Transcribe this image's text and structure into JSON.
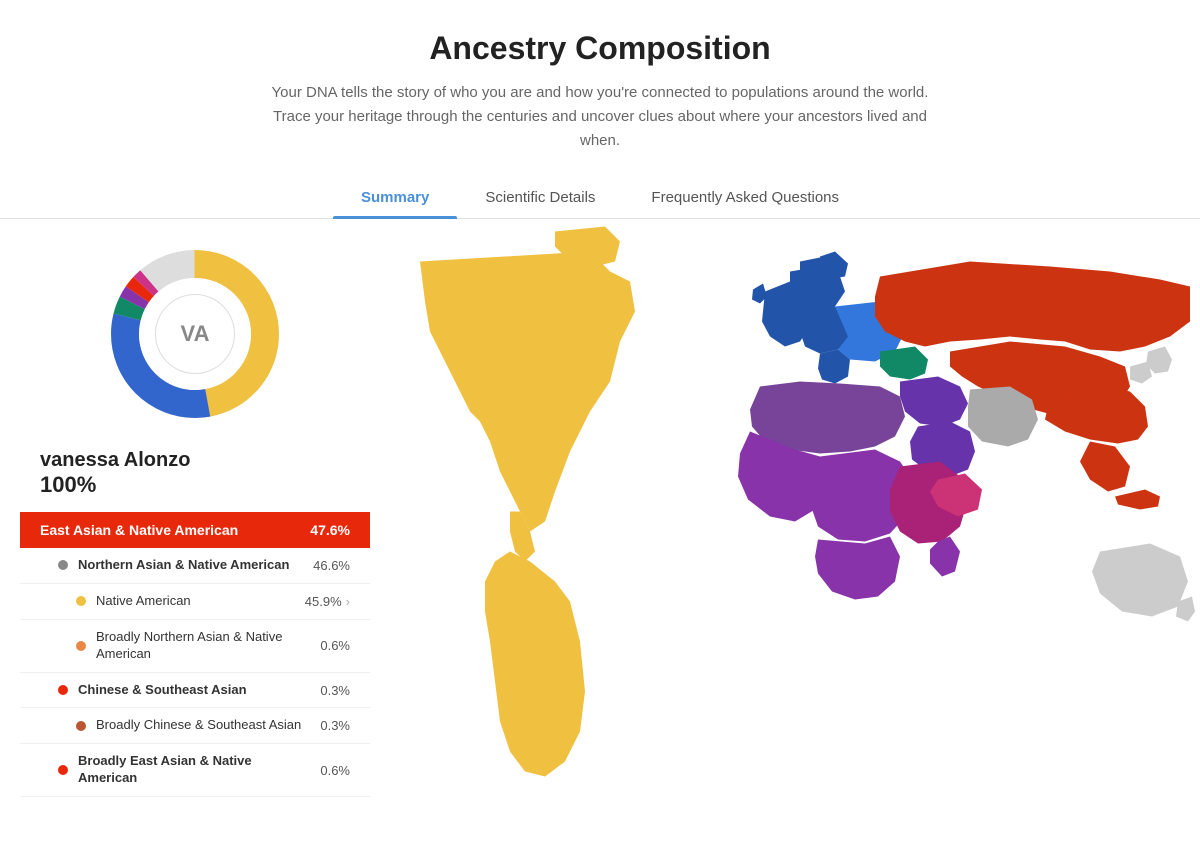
{
  "header": {
    "title": "Ancestry Composition",
    "subtitle": "Your DNA tells the story of who you are and how you're connected to populations around the world. Trace your heritage through the centuries and uncover clues about where your ancestors lived and when."
  },
  "tabs": [
    {
      "id": "summary",
      "label": "Summary",
      "active": true
    },
    {
      "id": "scientific",
      "label": "Scientific Details",
      "active": false
    },
    {
      "id": "faq",
      "label": "Frequently Asked Questions",
      "active": false
    }
  ],
  "user": {
    "initials": "VA",
    "name": "vanessa Alonzo",
    "percent": "100%"
  },
  "top_category": {
    "label": "East Asian & Native American",
    "pct": "47.6%"
  },
  "ancestry_items": [
    {
      "level": 1,
      "dot_color": "#555555",
      "name": "Northern Asian & Native American",
      "pct": "46.6%",
      "bold": true,
      "arrow": false
    },
    {
      "level": 2,
      "dot_color": "#f0c040",
      "name": "Native American",
      "pct": "45.9%",
      "bold": false,
      "arrow": true
    },
    {
      "level": 2,
      "dot_color": "#e88844",
      "name": "Broadly Northern Asian & Native American",
      "pct": "0.6%",
      "bold": false,
      "arrow": false
    },
    {
      "level": 1,
      "dot_color": "#e8280a",
      "name": "Chinese & Southeast Asian",
      "pct": "0.3%",
      "bold": true,
      "arrow": false
    },
    {
      "level": 2,
      "dot_color": "#aa4422",
      "name": "Broadly Chinese & Southeast Asian",
      "pct": "0.3%",
      "bold": false,
      "arrow": false
    },
    {
      "level": 1,
      "dot_color": "#e8280a",
      "name": "Broadly East Asian & Native American",
      "pct": "0.6%",
      "bold": true,
      "arrow": false
    }
  ]
}
